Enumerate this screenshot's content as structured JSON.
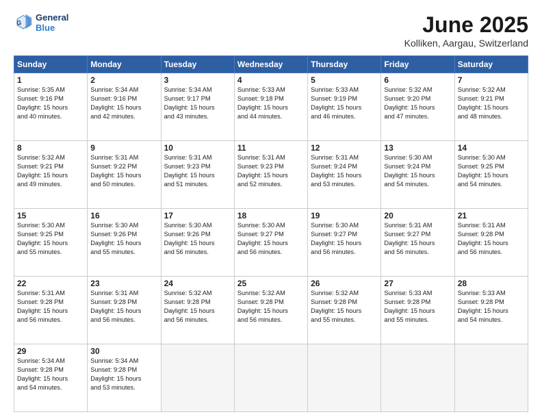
{
  "header": {
    "logo_line1": "General",
    "logo_line2": "Blue",
    "title": "June 2025",
    "subtitle": "Kolliken, Aargau, Switzerland"
  },
  "calendar": {
    "days_of_week": [
      "Sunday",
      "Monday",
      "Tuesday",
      "Wednesday",
      "Thursday",
      "Friday",
      "Saturday"
    ],
    "weeks": [
      [
        {
          "num": "",
          "info": ""
        },
        {
          "num": "2",
          "info": "Sunrise: 5:34 AM\nSunset: 9:16 PM\nDaylight: 15 hours\nand 42 minutes."
        },
        {
          "num": "3",
          "info": "Sunrise: 5:34 AM\nSunset: 9:17 PM\nDaylight: 15 hours\nand 43 minutes."
        },
        {
          "num": "4",
          "info": "Sunrise: 5:33 AM\nSunset: 9:18 PM\nDaylight: 15 hours\nand 44 minutes."
        },
        {
          "num": "5",
          "info": "Sunrise: 5:33 AM\nSunset: 9:19 PM\nDaylight: 15 hours\nand 46 minutes."
        },
        {
          "num": "6",
          "info": "Sunrise: 5:32 AM\nSunset: 9:20 PM\nDaylight: 15 hours\nand 47 minutes."
        },
        {
          "num": "7",
          "info": "Sunrise: 5:32 AM\nSunset: 9:21 PM\nDaylight: 15 hours\nand 48 minutes."
        }
      ],
      [
        {
          "num": "8",
          "info": "Sunrise: 5:32 AM\nSunset: 9:21 PM\nDaylight: 15 hours\nand 49 minutes."
        },
        {
          "num": "9",
          "info": "Sunrise: 5:31 AM\nSunset: 9:22 PM\nDaylight: 15 hours\nand 50 minutes."
        },
        {
          "num": "10",
          "info": "Sunrise: 5:31 AM\nSunset: 9:23 PM\nDaylight: 15 hours\nand 51 minutes."
        },
        {
          "num": "11",
          "info": "Sunrise: 5:31 AM\nSunset: 9:23 PM\nDaylight: 15 hours\nand 52 minutes."
        },
        {
          "num": "12",
          "info": "Sunrise: 5:31 AM\nSunset: 9:24 PM\nDaylight: 15 hours\nand 53 minutes."
        },
        {
          "num": "13",
          "info": "Sunrise: 5:30 AM\nSunset: 9:24 PM\nDaylight: 15 hours\nand 54 minutes."
        },
        {
          "num": "14",
          "info": "Sunrise: 5:30 AM\nSunset: 9:25 PM\nDaylight: 15 hours\nand 54 minutes."
        }
      ],
      [
        {
          "num": "15",
          "info": "Sunrise: 5:30 AM\nSunset: 9:25 PM\nDaylight: 15 hours\nand 55 minutes."
        },
        {
          "num": "16",
          "info": "Sunrise: 5:30 AM\nSunset: 9:26 PM\nDaylight: 15 hours\nand 55 minutes."
        },
        {
          "num": "17",
          "info": "Sunrise: 5:30 AM\nSunset: 9:26 PM\nDaylight: 15 hours\nand 56 minutes."
        },
        {
          "num": "18",
          "info": "Sunrise: 5:30 AM\nSunset: 9:27 PM\nDaylight: 15 hours\nand 56 minutes."
        },
        {
          "num": "19",
          "info": "Sunrise: 5:30 AM\nSunset: 9:27 PM\nDaylight: 15 hours\nand 56 minutes."
        },
        {
          "num": "20",
          "info": "Sunrise: 5:31 AM\nSunset: 9:27 PM\nDaylight: 15 hours\nand 56 minutes."
        },
        {
          "num": "21",
          "info": "Sunrise: 5:31 AM\nSunset: 9:28 PM\nDaylight: 15 hours\nand 56 minutes."
        }
      ],
      [
        {
          "num": "22",
          "info": "Sunrise: 5:31 AM\nSunset: 9:28 PM\nDaylight: 15 hours\nand 56 minutes."
        },
        {
          "num": "23",
          "info": "Sunrise: 5:31 AM\nSunset: 9:28 PM\nDaylight: 15 hours\nand 56 minutes."
        },
        {
          "num": "24",
          "info": "Sunrise: 5:32 AM\nSunset: 9:28 PM\nDaylight: 15 hours\nand 56 minutes."
        },
        {
          "num": "25",
          "info": "Sunrise: 5:32 AM\nSunset: 9:28 PM\nDaylight: 15 hours\nand 56 minutes."
        },
        {
          "num": "26",
          "info": "Sunrise: 5:32 AM\nSunset: 9:28 PM\nDaylight: 15 hours\nand 55 minutes."
        },
        {
          "num": "27",
          "info": "Sunrise: 5:33 AM\nSunset: 9:28 PM\nDaylight: 15 hours\nand 55 minutes."
        },
        {
          "num": "28",
          "info": "Sunrise: 5:33 AM\nSunset: 9:28 PM\nDaylight: 15 hours\nand 54 minutes."
        }
      ],
      [
        {
          "num": "29",
          "info": "Sunrise: 5:34 AM\nSunset: 9:28 PM\nDaylight: 15 hours\nand 54 minutes."
        },
        {
          "num": "30",
          "info": "Sunrise: 5:34 AM\nSunset: 9:28 PM\nDaylight: 15 hours\nand 53 minutes."
        },
        {
          "num": "",
          "info": ""
        },
        {
          "num": "",
          "info": ""
        },
        {
          "num": "",
          "info": ""
        },
        {
          "num": "",
          "info": ""
        },
        {
          "num": "",
          "info": ""
        }
      ]
    ],
    "first_week_special": {
      "num": "1",
      "info": "Sunrise: 5:35 AM\nSunset: 9:16 PM\nDaylight: 15 hours\nand 40 minutes."
    }
  }
}
